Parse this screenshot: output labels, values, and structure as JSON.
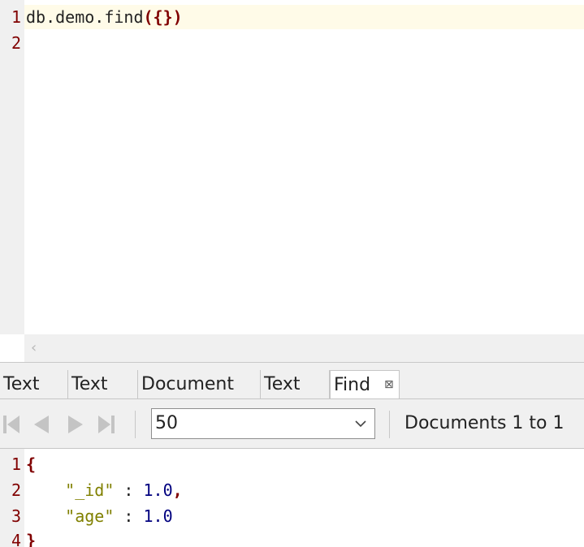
{
  "editor": {
    "lines": [
      {
        "num": "1",
        "text": "db.demo.find",
        "open": "({",
        "close": "})"
      },
      {
        "num": "2",
        "text": ""
      }
    ],
    "scroll_left_icon": "chevron-left-icon"
  },
  "tabs": [
    {
      "label": "Text"
    },
    {
      "label": "Text"
    },
    {
      "label": "Document"
    },
    {
      "label": "Text"
    },
    {
      "label": "Find",
      "active": true,
      "close_glyph": "⊠"
    }
  ],
  "toolbar": {
    "first_icon": "skip-first-icon",
    "prev_icon": "previous-icon",
    "next_icon": "next-icon",
    "last_icon": "skip-last-icon",
    "page_size": "50",
    "page_size_arrow": "chevron-down-icon",
    "count_text": "Documents 1 to 1"
  },
  "results": {
    "lines": [
      {
        "num": "1",
        "brace": "{"
      },
      {
        "num": "2",
        "indent": "    ",
        "key": "\"_id\"",
        "sep": " : ",
        "value": "1.0",
        "trail": ","
      },
      {
        "num": "3",
        "indent": "    ",
        "key": "\"age\"",
        "sep": " : ",
        "value": "1.0",
        "trail": ""
      },
      {
        "num": "4",
        "brace": "}"
      }
    ]
  },
  "colors": {
    "brace": "#800000",
    "key": "#808000",
    "number": "#00007f",
    "current_line": "#fffbe8"
  }
}
